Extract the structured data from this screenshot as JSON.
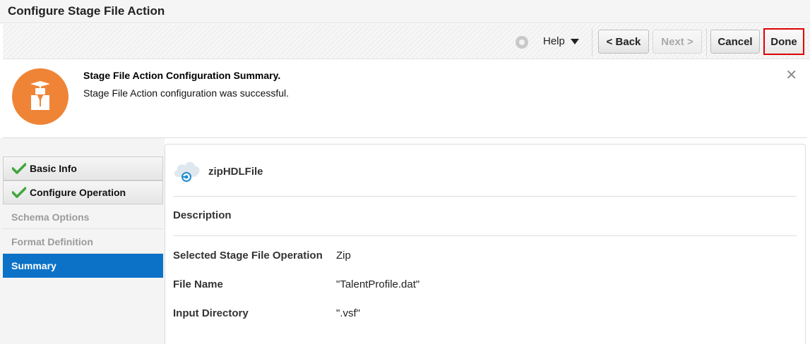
{
  "title": "Configure Stage File Action",
  "toolbar": {
    "help_icon": "help-circle-icon",
    "help_label": "Help",
    "back_label": "< Back",
    "next_label": "Next >",
    "cancel_label": "Cancel",
    "done_label": "Done"
  },
  "banner": {
    "icon": "graduate-icon",
    "title": "Stage File Action Configuration Summary.",
    "body": "Stage File Action configuration was successful.",
    "close_glyph": "✕"
  },
  "nav": {
    "items": [
      {
        "label": "Basic Info",
        "state": "completed"
      },
      {
        "label": "Configure Operation",
        "state": "completed"
      },
      {
        "label": "Schema Options",
        "state": "pending"
      },
      {
        "label": "Format Definition",
        "state": "pending"
      },
      {
        "label": "Summary",
        "state": "active"
      }
    ]
  },
  "summary": {
    "connection_name": "zipHDLFile",
    "description_heading": "Description",
    "rows": [
      {
        "label": "Selected Stage File Operation",
        "value": "Zip"
      },
      {
        "label": "File Name",
        "value": "\"TalentProfile.dat\""
      },
      {
        "label": "Input Directory",
        "value": "\".vsf\""
      }
    ]
  },
  "colors": {
    "accent": "#0c72c7",
    "logo": "#ef8436",
    "done_border": "#e00000",
    "check": "#3ea63a"
  }
}
